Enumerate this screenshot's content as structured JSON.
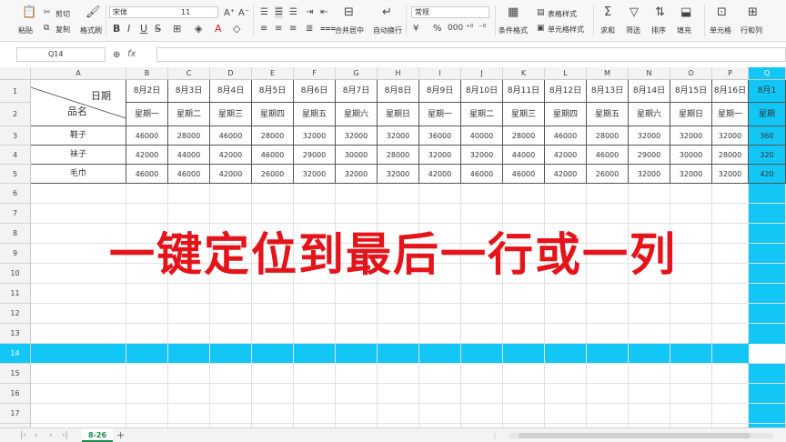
{
  "toolbar": {
    "paste": "粘贴",
    "cut": "剪切",
    "copy": "复制",
    "format_painter": "格式刷",
    "font_name": "宋体",
    "font_size": "11",
    "merge_center": "合并居中",
    "wrap_text": "自动换行",
    "number_format": "常规",
    "conditional_format": "条件格式",
    "table_style": "表格样式",
    "cell_style": "单元格样式",
    "sum": "求和",
    "filter": "筛选",
    "sort": "排序",
    "fill": "填充",
    "cell": "单元格",
    "row_col": "行和列"
  },
  "formula_bar": {
    "name_box": "Q14",
    "fx": "fx"
  },
  "columns": [
    "A",
    "B",
    "C",
    "D",
    "E",
    "F",
    "G",
    "H",
    "I",
    "J",
    "K",
    "L",
    "M",
    "N",
    "O",
    "P",
    "Q"
  ],
  "rows": [
    "1",
    "2",
    "3",
    "4",
    "5",
    "6",
    "7",
    "8",
    "9",
    "10",
    "11",
    "12",
    "13",
    "14",
    "15",
    "16",
    "17",
    "18"
  ],
  "header": {
    "corner_top": "日期",
    "corner_bottom": "品名",
    "dates": [
      "8月2日",
      "8月3日",
      "8月4日",
      "8月5日",
      "8月6日",
      "8月7日",
      "8月8日",
      "8月9日",
      "8月10日",
      "8月11日",
      "8月12日",
      "8月13日",
      "8月14日",
      "8月15日",
      "8月16日",
      "8月1"
    ],
    "weekdays": [
      "星期一",
      "星期二",
      "星期三",
      "星期四",
      "星期五",
      "星期六",
      "星期日",
      "星期一",
      "星期二",
      "星期三",
      "星期四",
      "星期五",
      "星期六",
      "星期日",
      "星期一",
      "星期"
    ]
  },
  "table": [
    {
      "name": "鞋子",
      "values": [
        "46000",
        "28000",
        "46000",
        "28000",
        "32000",
        "32000",
        "32000",
        "36000",
        "40000",
        "28000",
        "46000",
        "28000",
        "32000",
        "32000",
        "32000",
        "360"
      ]
    },
    {
      "name": "袜子",
      "values": [
        "42000",
        "44000",
        "42000",
        "46000",
        "29000",
        "30000",
        "28000",
        "32000",
        "32000",
        "44000",
        "42000",
        "46000",
        "29000",
        "30000",
        "28000",
        "320"
      ]
    },
    {
      "name": "毛巾",
      "values": [
        "46000",
        "46000",
        "42000",
        "26000",
        "32000",
        "32000",
        "32000",
        "42000",
        "46000",
        "46000",
        "42000",
        "26000",
        "32000",
        "32000",
        "32000",
        "420"
      ]
    }
  ],
  "overlay_text": "一键定位到最后一行或一列",
  "sheet_tab": "8-26",
  "highlight_color": "#12c6f5",
  "overlay_color": "#e4141a"
}
